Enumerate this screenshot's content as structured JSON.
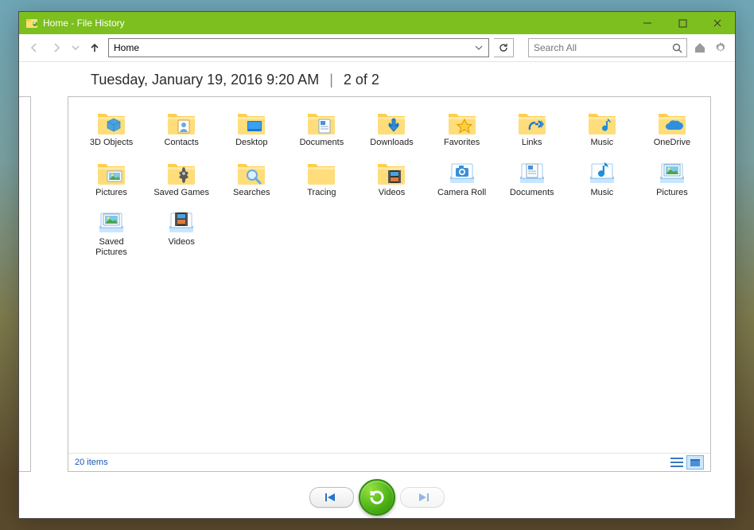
{
  "window": {
    "title": "Home - File History"
  },
  "toolbar": {
    "address_value": "Home",
    "search_placeholder": "Search All"
  },
  "header": {
    "datetime": "Tuesday, January 19, 2016 9:20 AM",
    "page_indicator": "2 of 2"
  },
  "items": [
    {
      "label": "3D Objects",
      "icon": "folder-3d"
    },
    {
      "label": "Contacts",
      "icon": "folder-contacts"
    },
    {
      "label": "Desktop",
      "icon": "folder-desktop"
    },
    {
      "label": "Documents",
      "icon": "folder-documents"
    },
    {
      "label": "Downloads",
      "icon": "folder-downloads"
    },
    {
      "label": "Favorites",
      "icon": "folder-favorites"
    },
    {
      "label": "Links",
      "icon": "folder-links"
    },
    {
      "label": "Music",
      "icon": "folder-music"
    },
    {
      "label": "OneDrive",
      "icon": "folder-onedrive"
    },
    {
      "label": "Pictures",
      "icon": "folder-pictures"
    },
    {
      "label": "Saved Games",
      "icon": "folder-savedgames"
    },
    {
      "label": "Searches",
      "icon": "folder-searches"
    },
    {
      "label": "Tracing",
      "icon": "folder-plain"
    },
    {
      "label": "Videos",
      "icon": "folder-videos"
    },
    {
      "label": "Camera Roll",
      "icon": "lib-camera"
    },
    {
      "label": "Documents",
      "icon": "lib-documents"
    },
    {
      "label": "Music",
      "icon": "lib-music"
    },
    {
      "label": "Pictures",
      "icon": "lib-pictures"
    },
    {
      "label": "Saved Pictures",
      "icon": "lib-pictures"
    },
    {
      "label": "Videos",
      "icon": "lib-videos"
    }
  ],
  "status": {
    "count_text": "20 items"
  }
}
